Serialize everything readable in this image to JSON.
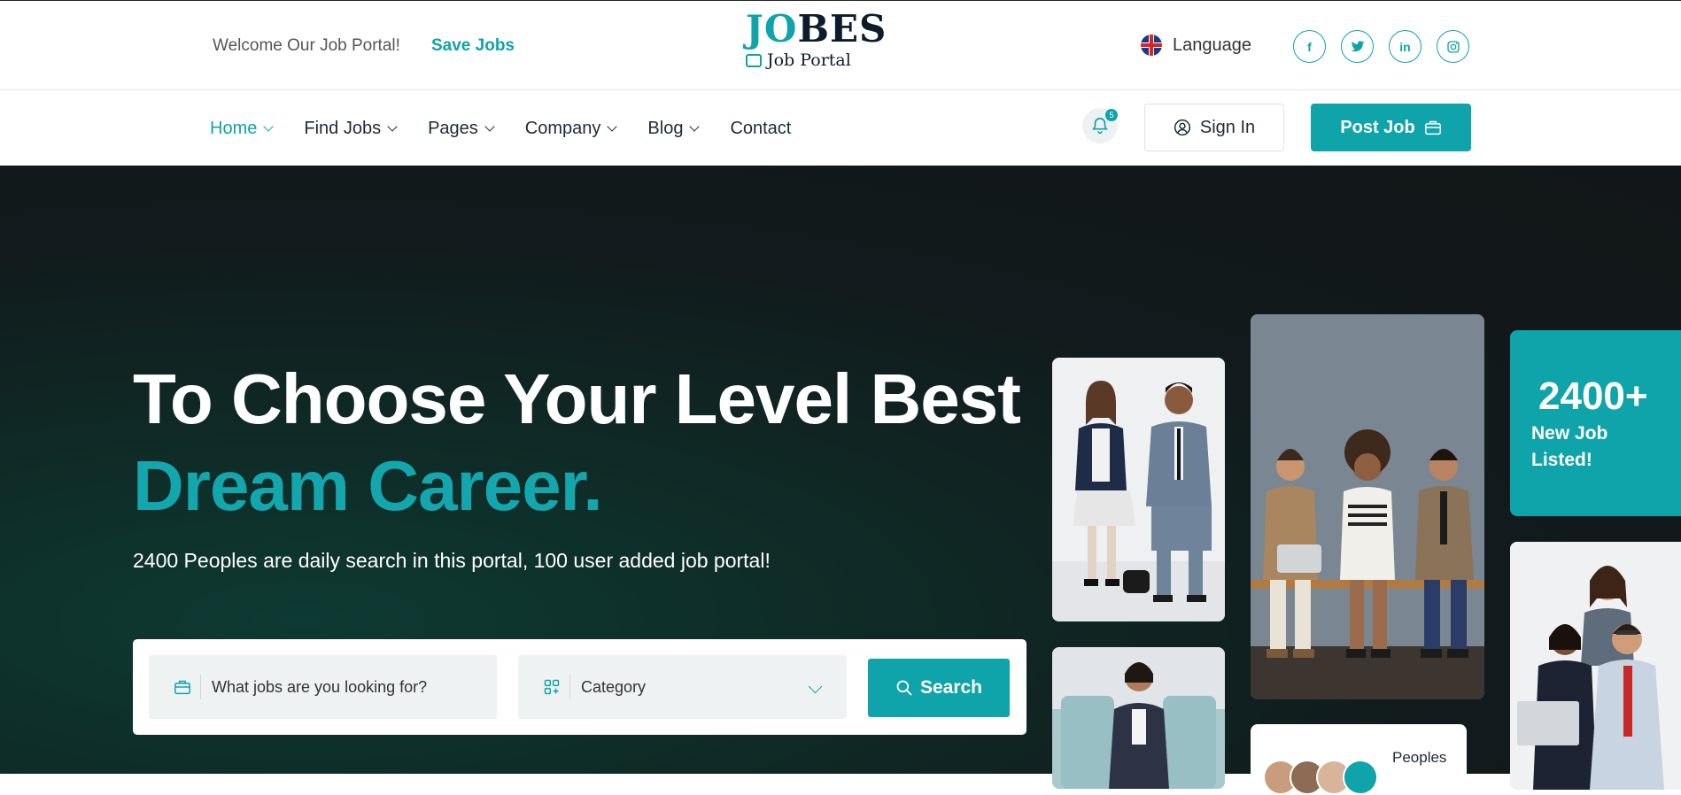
{
  "topbar": {
    "welcome_text": "Welcome Our Job Portal!",
    "save_jobs_link": "Save Jobs",
    "logo_jo": "JO",
    "logo_bes": "BES",
    "logo_sub": "Job Portal",
    "language_label": "Language",
    "social_icons": [
      "facebook-icon",
      "twitter-icon",
      "linkedin-icon",
      "instagram-icon"
    ],
    "social_glyphs": {
      "facebook": "f",
      "twitter": "t",
      "linkedin": "in",
      "instagram": "◎"
    }
  },
  "nav": {
    "items": [
      {
        "label": "Home",
        "has_dropdown": true,
        "active": true
      },
      {
        "label": "Find Jobs",
        "has_dropdown": true,
        "active": false
      },
      {
        "label": "Pages",
        "has_dropdown": true,
        "active": false
      },
      {
        "label": "Company",
        "has_dropdown": true,
        "active": false
      },
      {
        "label": "Blog",
        "has_dropdown": true,
        "active": false
      },
      {
        "label": "Contact",
        "has_dropdown": false,
        "active": false
      }
    ],
    "notification_count": "5",
    "sign_in_label": "Sign In",
    "post_job_label": "Post Job"
  },
  "hero": {
    "headline_line1": "To Choose Your Level Best",
    "headline_line2": "Dream Career.",
    "subtitle": "2400 Peoples are daily search in this portal, 100 user added job portal!"
  },
  "search": {
    "job_placeholder": "What jobs are you looking for?",
    "category_value": "Category",
    "search_button": "Search"
  },
  "stats": {
    "jobs_count": "2400+",
    "jobs_label": "New Job Listed!",
    "peoples_label": "Peoples"
  },
  "colors": {
    "accent": "#0fa3aa",
    "dark": "#0d1b2a",
    "hero_bg": "#121617"
  }
}
